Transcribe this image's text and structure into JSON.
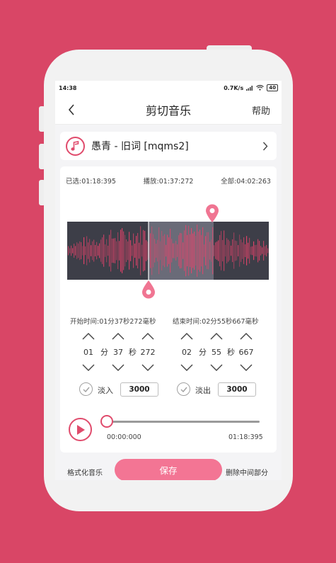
{
  "status_bar": {
    "time": "14:38",
    "network_speed": "0.7K/s",
    "battery": "40"
  },
  "nav": {
    "title": "剪切音乐",
    "help_label": "帮助"
  },
  "song": {
    "name": "愚青 - 旧词 [mqms2]"
  },
  "times": {
    "selected": "已选:01:18:395",
    "playing": "播放:01:37:272",
    "total": "全部:04:02:263"
  },
  "start_time": {
    "label": "开始时间:01分37秒272毫秒",
    "minutes": "01",
    "seconds": "37",
    "millis": "272",
    "min_unit": "分",
    "sec_unit": "秒"
  },
  "end_time": {
    "label": "结束时间:02分55秒667毫秒",
    "minutes": "02",
    "seconds": "55",
    "millis": "667",
    "min_unit": "分",
    "sec_unit": "秒"
  },
  "fade": {
    "in_label": "淡入",
    "in_value": "3000",
    "out_label": "淡出",
    "out_value": "3000"
  },
  "player": {
    "current": "00:00:000",
    "end": "01:18:395"
  },
  "bottom": {
    "left_label": "格式化音乐",
    "save_label": "保存",
    "right_label": "删除中间部分"
  },
  "colors": {
    "accent": "#e04b6c",
    "background": "#d94666",
    "save_button": "#f37594",
    "waveform_bg": "#3d3e48",
    "waveform": "#e8436b"
  },
  "icons": {
    "back": "chevron-left-icon",
    "music": "music-note-icon",
    "song_chevron": "chevron-right-icon",
    "pin": "map-pin-icon",
    "up": "chevron-up-icon",
    "down": "chevron-down-icon",
    "check": "check-circle-icon",
    "play": "play-icon"
  }
}
